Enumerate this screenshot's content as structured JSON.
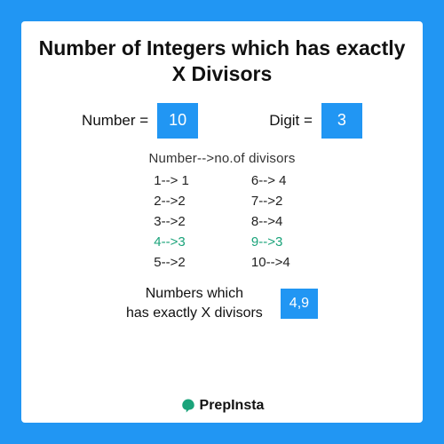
{
  "title": "Number of Integers which has exactly X Divisors",
  "inputs": {
    "number_label": "Number =",
    "number_value": "10",
    "digit_label": "Digit =",
    "digit_value": "3"
  },
  "subtitle": "Number-->no.of  divisors",
  "table": {
    "left": [
      {
        "text": "1--> 1",
        "highlight": false
      },
      {
        "text": "2-->2",
        "highlight": false
      },
      {
        "text": "3-->2",
        "highlight": false
      },
      {
        "text": "4-->3",
        "highlight": true
      },
      {
        "text": "5-->2",
        "highlight": false
      }
    ],
    "right": [
      {
        "text": "6--> 4",
        "highlight": false
      },
      {
        "text": "7-->2",
        "highlight": false
      },
      {
        "text": "8-->4",
        "highlight": false
      },
      {
        "text": "9-->3",
        "highlight": true
      },
      {
        "text": "10-->4",
        "highlight": false
      }
    ]
  },
  "result": {
    "label_line1": "Numbers which",
    "label_line2": "has exactly X divisors",
    "value": "4,9"
  },
  "brand": "PrepInsta",
  "colors": {
    "accent": "#2196f3",
    "highlight": "#1aa37a"
  }
}
